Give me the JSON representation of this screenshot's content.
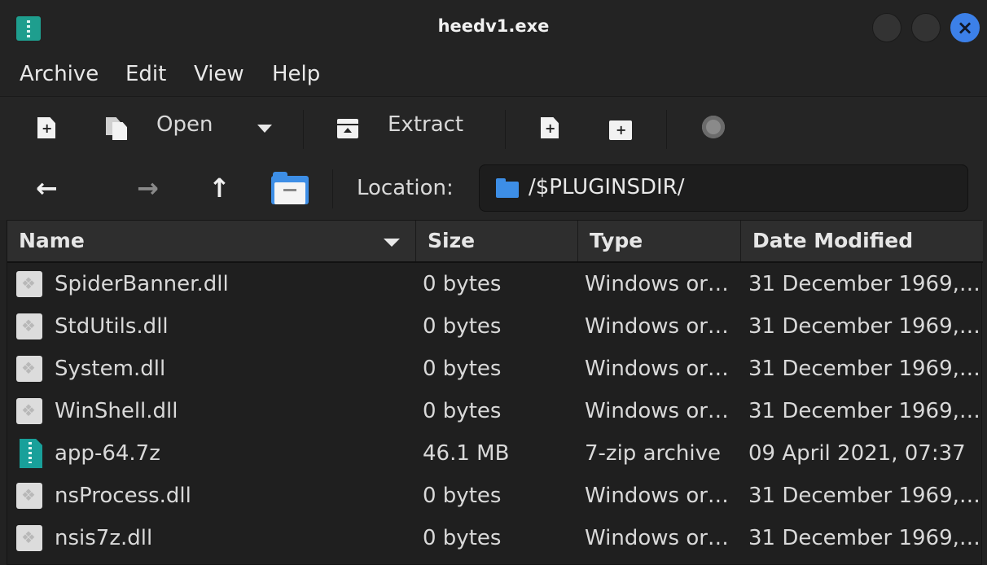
{
  "window": {
    "title": "heedv1.exe"
  },
  "menu": [
    "Archive",
    "Edit",
    "View",
    "Help"
  ],
  "toolbar": {
    "open_label": "Open",
    "extract_label": "Extract"
  },
  "location": {
    "label": "Location:",
    "path": "/$PLUGINSDIR/"
  },
  "columns": [
    "Name",
    "Size",
    "Type",
    "Date Modified"
  ],
  "files": [
    {
      "name": "SpiderBanner.dll",
      "size": "0 bytes",
      "type": "Windows or…",
      "date": "31 December 1969,…",
      "icon": "dll-file-icon"
    },
    {
      "name": "StdUtils.dll",
      "size": "0 bytes",
      "type": "Windows or…",
      "date": "31 December 1969,…",
      "icon": "dll-file-icon"
    },
    {
      "name": "System.dll",
      "size": "0 bytes",
      "type": "Windows or…",
      "date": "31 December 1969,…",
      "icon": "dll-file-icon"
    },
    {
      "name": "WinShell.dll",
      "size": "0 bytes",
      "type": "Windows or…",
      "date": "31 December 1969,…",
      "icon": "dll-file-icon"
    },
    {
      "name": "app-64.7z",
      "size": "46.1 MB",
      "type": "7-zip archive",
      "date": "09 April 2021, 07:37",
      "icon": "archive-file-icon"
    },
    {
      "name": "nsProcess.dll",
      "size": "0 bytes",
      "type": "Windows or…",
      "date": "31 December 1969,…",
      "icon": "dll-file-icon"
    },
    {
      "name": "nsis7z.dll",
      "size": "0 bytes",
      "type": "Windows or…",
      "date": "31 December 1969,…",
      "icon": "dll-file-icon"
    }
  ],
  "colors": {
    "accent": "#3c80e8",
    "folder": "#3d8ee6",
    "archive": "#18a09a"
  }
}
